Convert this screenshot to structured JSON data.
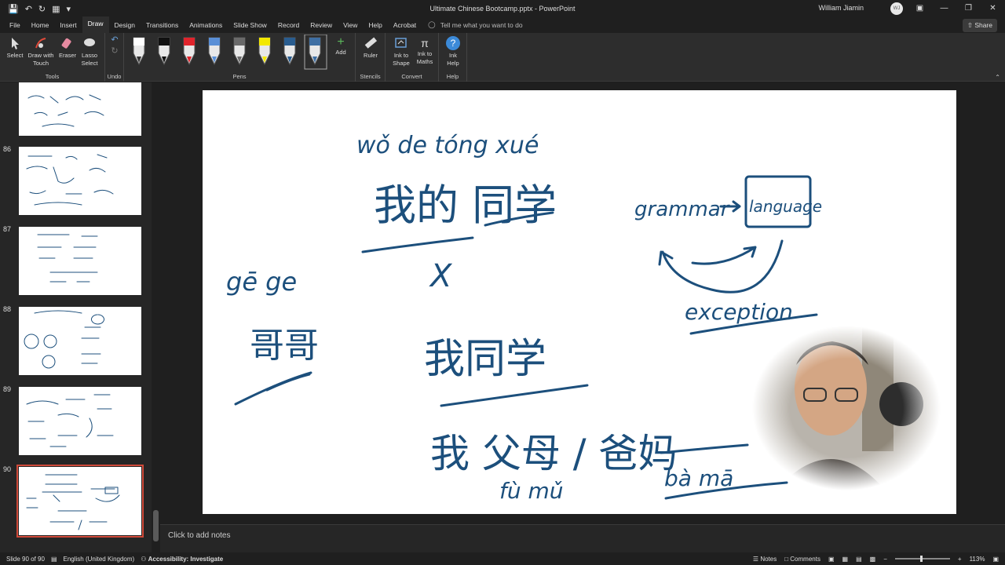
{
  "window": {
    "title": "Ultimate Chinese Bootcamp.pptx  -  PowerPoint",
    "user": "William Jiamin",
    "avatar_initials": "WJ"
  },
  "tabs": [
    "File",
    "Home",
    "Insert",
    "Draw",
    "Design",
    "Transitions",
    "Animations",
    "Slide Show",
    "Record",
    "Review",
    "View",
    "Help",
    "Acrobat"
  ],
  "active_tab": "Draw",
  "tell_me": "Tell me what you want to do",
  "share_label": "Share",
  "ribbon": {
    "tools": {
      "label": "Tools",
      "select": "Select",
      "draw_with_touch": "Draw with Touch",
      "eraser": "Eraser",
      "lasso_select": "Lasso Select"
    },
    "undo": {
      "label": "Undo"
    },
    "pens": {
      "label": "Pens",
      "add": "Add"
    },
    "stencils": {
      "label": "Stencils",
      "ruler": "Ruler"
    },
    "convert": {
      "label": "Convert",
      "ink_to_shape": "Ink to Shape",
      "ink_to_maths": "Ink to Maths"
    },
    "help": {
      "label": "Help",
      "ink_help": "Ink Help"
    }
  },
  "pen_colors": [
    "#ffffff",
    "#111111",
    "#e0242c",
    "#5a8fd6",
    "#6a6a6a",
    "#f3e800",
    "#2a5d8f",
    "#3f6fa3"
  ],
  "slides": [
    {
      "number": "",
      "selected": false
    },
    {
      "number": "86",
      "selected": false
    },
    {
      "number": "87",
      "selected": false
    },
    {
      "number": "88",
      "selected": false
    },
    {
      "number": "89",
      "selected": false
    },
    {
      "number": "90",
      "selected": true
    }
  ],
  "slide_content": {
    "pinyin_1": "wǒ  de  tóng xué",
    "hanzi_1": "我的 同学",
    "mark_x": "X",
    "pinyin_gege": "gē ge",
    "hanzi_gege": "哥哥",
    "english_1": "grammar",
    "english_2": "language",
    "english_3": "exception",
    "hanzi_2": "我同学",
    "hanzi_3": "我 父母 / 爸妈",
    "pinyin_3a": "fù  mǔ",
    "pinyin_3b": "bà  mā"
  },
  "notes_placeholder": "Click to add notes",
  "status": {
    "slide": "Slide 90 of 90",
    "language": "English (United Kingdom)",
    "accessibility": "Accessibility: Investigate",
    "notes": "Notes",
    "comments": "Comments",
    "zoom": "113%"
  }
}
